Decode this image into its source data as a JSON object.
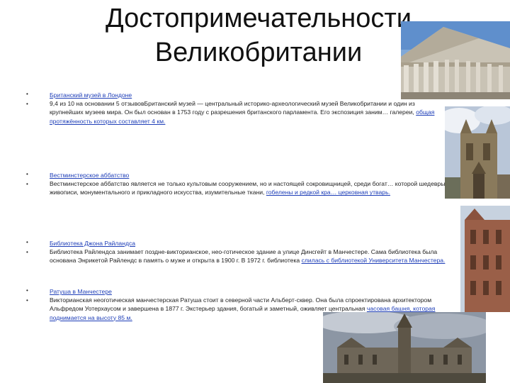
{
  "slide": {
    "title_line1": "Достопримечательности",
    "title_line2": "Великобритании"
  },
  "sections": [
    {
      "link": "Британский музей в Лондоне",
      "text_prefix": " 9,4 из 10 на основании 5 отзывов",
      "text_main": "Британский музей — центральный историко-археологический музей Великобритании и один из крупнейших музеев мира. Он был основан в 1753 году с разрешения британского парламента. Его экспозиция заним… галереи, ",
      "inline_link": "общая протяжённость которых составляет 4 км."
    },
    {
      "link": "Вестминстерское аббатство",
      "text_main": "Вестминстерское аббатство является не только культовым сооружением, но и настоящей сокровищницей, среди богат… которой шедевры живописи, монументального и прикладного искусства, изумительные ткани, ",
      "inline_link": "гобелены и редкой кра… церковная утварь."
    },
    {
      "link": "Библиотека Джона Райландса",
      "text_main": "Библиотека Райлендса занимает поздне-викторианское, нео-готическое здание а улице Динсгейт в Манчестере. Сама библиотека была основана Энрикетой Райлендс в память о муже и открыта в 1900 г. В 1972 г. библиотека ",
      "inline_link": "слилась с библиотекой Университета Манчестера."
    },
    {
      "link": "Ратуша в Манчестере",
      "text_main": "Викторианская неоготическая манчестерская Ратуша стоит в северной части Альберт-сквер. Она была спроектирована архитектором Альфредом Уотерхаусом и завершена в 1877 г. Экстерьер здания, богатый и заметный, оживляет центральная ",
      "inline_link": "часовая башня, которая поднимается на высоту 85 м."
    }
  ],
  "bullet_glyph": "•",
  "images": [
    {
      "icon": "british-museum-photo"
    },
    {
      "icon": "westminster-abbey-photo"
    },
    {
      "icon": "rylands-library-photo"
    },
    {
      "icon": "manchester-town-hall-photo"
    }
  ]
}
